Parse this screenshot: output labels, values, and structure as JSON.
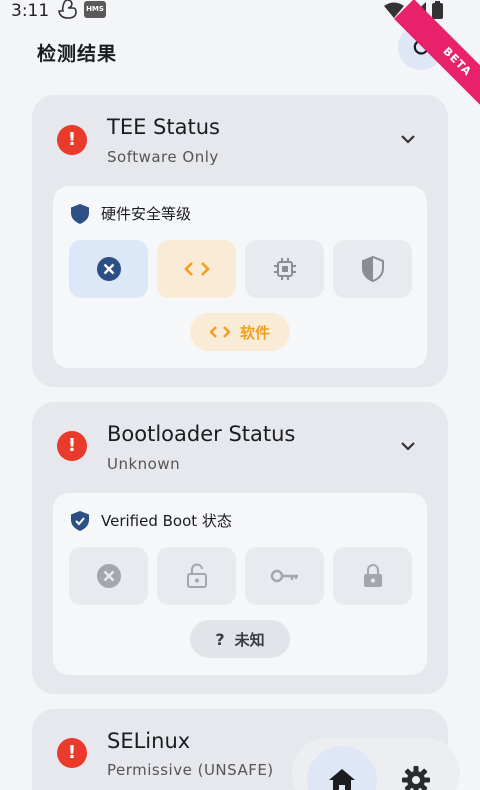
{
  "status_bar": {
    "time": "3:11",
    "hms_label": "HMS"
  },
  "header": {
    "title": "检测结果",
    "beta_label": "BETA"
  },
  "cards": [
    {
      "title": "TEE Status",
      "subtitle": "Software Only",
      "section_title": "硬件安全等级",
      "pill_label": "软件",
      "tile_icons": [
        "close-circle-icon",
        "code-icon",
        "chip-icon",
        "shield-icon"
      ]
    },
    {
      "title": "Bootloader Status",
      "subtitle": "Unknown",
      "section_title": "Verified Boot 状态",
      "pill_label": "未知",
      "tile_icons": [
        "close-circle-icon",
        "lock-open-icon",
        "key-icon",
        "lock-icon"
      ]
    },
    {
      "title": "SELinux",
      "subtitle": "Permissive (UNSAFE)"
    }
  ],
  "colors": {
    "error": "#ea3a2c",
    "shield": "#2c4f86",
    "selected_blue_bg": "#dce8f8",
    "selected_orange_bg": "#f9ebd5",
    "orange": "#f0a020",
    "beta": "#e8226a"
  }
}
